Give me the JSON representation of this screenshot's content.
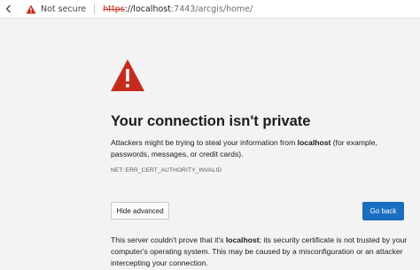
{
  "browser": {
    "security_label": "Not secure",
    "url_scheme": "https",
    "url_host_part": "://localhost",
    "url_path": ":7443/arcgis/home/"
  },
  "page": {
    "title": "Your connection isn't private",
    "description_before": "Attackers might be trying to steal your information from ",
    "description_host": "localhost",
    "description_after": " (for example, passwords, messages, or credit cards).",
    "error_code": "NET::ERR_CERT_AUTHORITY_INVALID",
    "hide_advanced_label": "Hide advanced",
    "go_back_label": "Go back",
    "details_before": "This server couldn't prove that it's ",
    "details_host": "localhost",
    "details_after": "; its security certificate is not trusted by your computer's operating system. This may be caused by a misconfiguration or an attacker intercepting your connection."
  },
  "colors": {
    "warning_red": "#c42b1c",
    "primary_button": "#1a6ec0",
    "background": "#f3f3f3"
  },
  "icons": {
    "back": "back-arrow-icon",
    "not_secure": "warning-triangle-icon",
    "page_warning": "warning-triangle-icon"
  }
}
